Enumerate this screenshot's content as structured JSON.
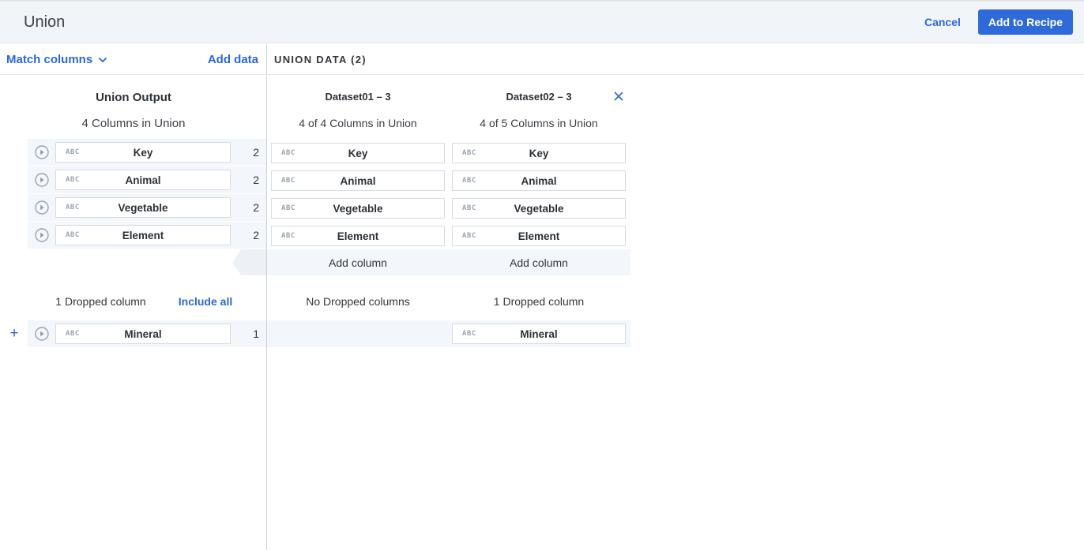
{
  "header": {
    "title": "Union",
    "cancel_label": "Cancel",
    "add_to_recipe_label": "Add to Recipe"
  },
  "toolbar": {
    "match_columns_label": "Match columns",
    "add_data_label": "Add data",
    "union_data_label": "UNION DATA (2)"
  },
  "union_output": {
    "title": "Union Output",
    "subtitle": "4 Columns in Union",
    "type_icon_label": "ABC",
    "columns": [
      {
        "name": "Key",
        "count": "2"
      },
      {
        "name": "Animal",
        "count": "2"
      },
      {
        "name": "Vegetable",
        "count": "2"
      },
      {
        "name": "Element",
        "count": "2"
      }
    ],
    "dropped_summary": "1 Dropped column",
    "include_all_label": "Include all",
    "dropped_columns": [
      {
        "name": "Mineral",
        "count": "1"
      }
    ]
  },
  "datasets": [
    {
      "title": "Dataset01 – 3",
      "subtitle": "4 of 4 Columns in Union",
      "columns": [
        "Key",
        "Animal",
        "Vegetable",
        "Element"
      ],
      "add_column_label": "Add column",
      "dropped_summary": "No Dropped columns",
      "dropped_columns": []
    },
    {
      "title": "Dataset02 – 3",
      "subtitle": "4 of 5 Columns in Union",
      "columns": [
        "Key",
        "Animal",
        "Vegetable",
        "Element"
      ],
      "add_column_label": "Add column",
      "dropped_summary": "1 Dropped column",
      "dropped_columns": [
        "Mineral"
      ]
    }
  ],
  "colors": {
    "accent_blue": "#2a68d8",
    "button_blue": "#2e6bd8",
    "row_band": "#f3f6fa",
    "divider": "#c9d3de",
    "icon_gray": "#9aa5b2"
  }
}
